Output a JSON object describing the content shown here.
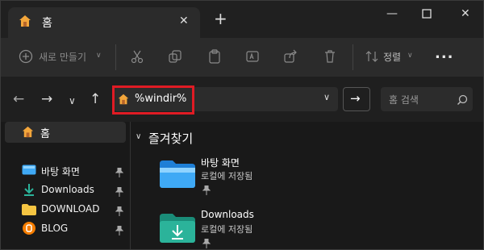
{
  "tab": {
    "title": "홈"
  },
  "toolbar": {
    "new_label": "새로 만들기",
    "sort_label": "정렬",
    "more_label": "..."
  },
  "address": {
    "path": "%windir%"
  },
  "search": {
    "placeholder": "홈 검색"
  },
  "sidebar": {
    "home_label": "홈",
    "items": [
      {
        "label": "바탕 화면",
        "icon": "desktop-icon"
      },
      {
        "label": "Downloads",
        "icon": "download-icon"
      },
      {
        "label": "DOWNLOAD",
        "icon": "folder-icon"
      },
      {
        "label": "BLOG",
        "icon": "blogger-icon"
      }
    ]
  },
  "content": {
    "section_title": "즐겨찾기",
    "items": [
      {
        "name": "바탕 화면",
        "sub": "로컬에 저장됨",
        "icon": "desktop-folder-icon"
      },
      {
        "name": "Downloads",
        "sub": "로컬에 저장됨",
        "icon": "downloads-folder-icon"
      }
    ]
  },
  "colors": {
    "highlight": "#e01b24",
    "folder_blue": "#3fa9f5",
    "folder_teal": "#2bb39a",
    "home_orange": "#f3a63b"
  }
}
